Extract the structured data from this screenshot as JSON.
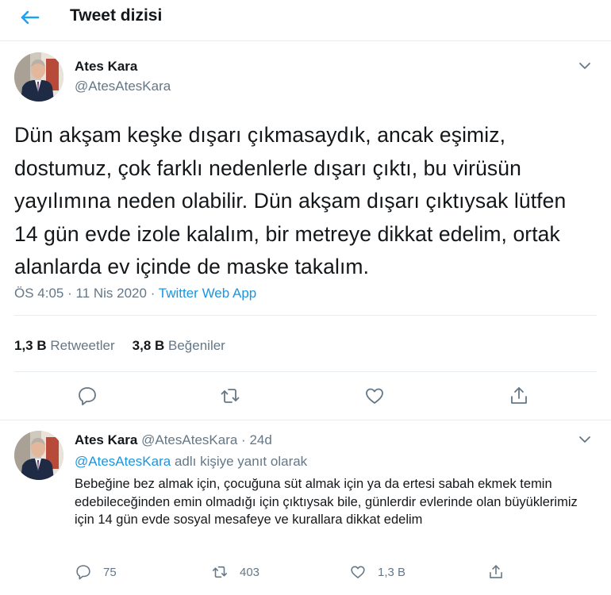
{
  "header": {
    "title": "Tweet dizisi"
  },
  "main_tweet": {
    "author_name": "Ates Kara",
    "author_handle": "@AtesAtesKara",
    "text": "Dün akşam keşke dışarı çıkmasaydık, ancak eşimiz, dostumuz, çok farklı nedenlerle dışarı çıktı, bu virüsün yayılımına neden olabilir. Dün akşam dışarı çıktıysak lütfen 14 gün evde izole kalalım, bir metreye dikkat edelim, ortak alanlarda ev içinde de maske takalım.",
    "time": "ÖS 4:05",
    "date": "11 Nis 2020",
    "source": "Twitter Web App",
    "retweets_count": "1,3 B",
    "retweets_label": "Retweetler",
    "likes_count": "3,8 B",
    "likes_label": "Beğeniler"
  },
  "reply_tweet": {
    "author_name": "Ates Kara",
    "author_handle": "@AtesAtesKara",
    "age": "24d",
    "reply_mention": "@AtesAtesKara",
    "reply_suffix": "adlı kişiye yanıt olarak",
    "text": "Bebeğine bez almak için, çocuğuna süt almak için ya da ertesi sabah ekmek temin edebileceğinden emin olmadığı için çıktıysak bile, günlerdir evlerinde olan büyüklerimiz için 14 gün evde sosyal mesafeye ve kurallara dikkat edelim",
    "reply_count": "75",
    "retweet_count": "403",
    "like_count": "1,3 B"
  },
  "colors": {
    "accent": "#1da1f2",
    "link": "#1b95e0",
    "secondary_text": "#657786",
    "border": "#e6ecf0"
  },
  "icons": [
    "back-arrow-icon",
    "chevron-down-icon",
    "reply-icon",
    "retweet-icon",
    "like-icon",
    "share-icon"
  ]
}
